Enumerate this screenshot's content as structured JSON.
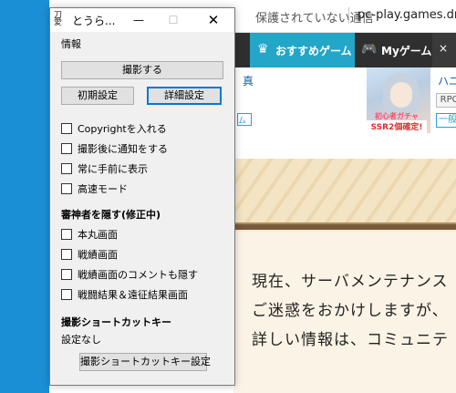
{
  "browser": {
    "security_text": "保護されていない通信",
    "url": "pc-play.games.dmm",
    "nav": {
      "active_label": "おすすめゲーム",
      "mygame_label": "Myゲーム",
      "close_label": "×"
    },
    "fragments": {
      "left_blue": "真",
      "left_tag": "ム"
    },
    "promo": {
      "badge_top": "初心者ガチャ",
      "badge_bottom": "SSR2個確定!",
      "title": "ハニー",
      "genre": "RPG",
      "tag": "一般ゲ"
    },
    "notice_lines": [
      "現在、サーバメンテナンス",
      "ご迷惑をおかけしますが、",
      "詳しい情報は、コミュニテ"
    ]
  },
  "window": {
    "title": "とうら...",
    "icon_glyph": "刀愛",
    "min_glyph": "—",
    "max_glyph": "☐",
    "close_glyph": "✕",
    "menu_label": "情報",
    "capture_button": "撮影する",
    "init_button": "初期設定",
    "detail_button": "詳細設定",
    "options": [
      {
        "label": "Copyrightを入れる",
        "checked": false
      },
      {
        "label": "撮影後に通知をする",
        "checked": false
      },
      {
        "label": "常に手前に表示",
        "checked": false
      },
      {
        "label": "高速モード",
        "checked": false
      }
    ],
    "hide_section_title": "審神者を隠す(修正中)",
    "hide_options": [
      {
        "label": "本丸画面",
        "checked": false
      },
      {
        "label": "戦績画面",
        "checked": false
      },
      {
        "label": "戦績画面のコメントも隠す",
        "checked": false
      },
      {
        "label": "戦闘結果＆遠征結果画面",
        "checked": false
      }
    ],
    "hotkey_section_title": "撮影ショートカットキー",
    "hotkey_value": "設定なし",
    "hotkey_button": "撮影ショートカットキー設定"
  }
}
